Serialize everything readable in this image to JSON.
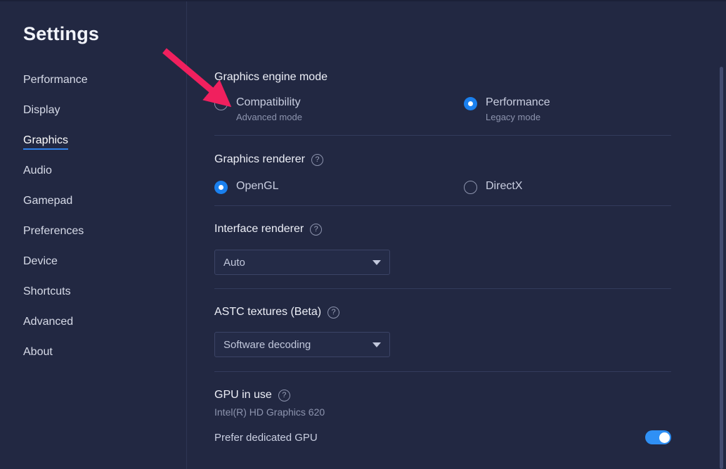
{
  "app": {
    "title": "Settings",
    "background_color": "#222842",
    "accent_color": "#2f80e8"
  },
  "sidebar": {
    "items": [
      {
        "label": "Performance",
        "active": false
      },
      {
        "label": "Display",
        "active": false
      },
      {
        "label": "Graphics",
        "active": true
      },
      {
        "label": "Audio",
        "active": false
      },
      {
        "label": "Gamepad",
        "active": false
      },
      {
        "label": "Preferences",
        "active": false
      },
      {
        "label": "Device",
        "active": false
      },
      {
        "label": "Shortcuts",
        "active": false
      },
      {
        "label": "Advanced",
        "active": false
      },
      {
        "label": "About",
        "active": false
      }
    ]
  },
  "main": {
    "engine_mode": {
      "title": "Graphics engine mode",
      "options": [
        {
          "label": "Compatibility",
          "sub": "Advanced mode",
          "selected": false
        },
        {
          "label": "Performance",
          "sub": "Legacy mode",
          "selected": true
        }
      ]
    },
    "graphics_renderer": {
      "title": "Graphics renderer",
      "help": "?",
      "options": [
        {
          "label": "OpenGL",
          "selected": true
        },
        {
          "label": "DirectX",
          "selected": false
        }
      ]
    },
    "interface_renderer": {
      "title": "Interface renderer",
      "help": "?",
      "value": "Auto"
    },
    "astc_textures": {
      "title": "ASTC textures (Beta)",
      "help": "?",
      "value": "Software decoding"
    },
    "gpu_in_use": {
      "title": "GPU in use",
      "help": "?",
      "device": "Intel(R) HD Graphics 620",
      "prefer_dedicated_label": "Prefer dedicated GPU",
      "prefer_dedicated_on": true
    }
  },
  "annotation": {
    "arrow_color": "#f0205e"
  }
}
